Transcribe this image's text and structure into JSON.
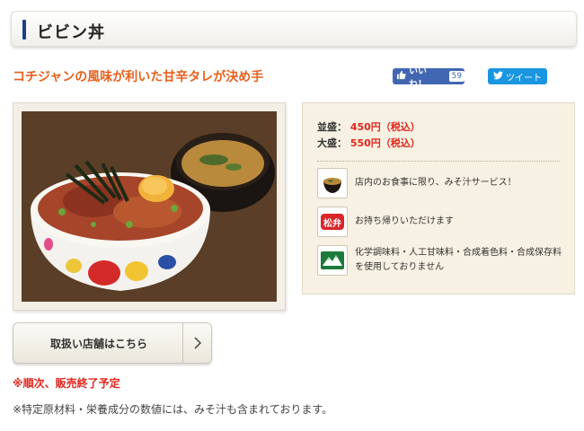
{
  "header": {
    "title": "ビビン丼"
  },
  "tagline": "コチジャンの風味が利いた甘辛タレが決め手",
  "social": {
    "like_label": "いいね！",
    "like_count": "59",
    "tweet_label": "ツイート"
  },
  "pricing": {
    "regular_label": "並盛：",
    "regular_price": "450円（税込）",
    "large_label": "大盛：",
    "large_price": "550円（税込）"
  },
  "services": [
    {
      "icon": "miso-soup-icon",
      "text": "店内のお食事に限り、みそ汁サービス！"
    },
    {
      "icon": "takeout-logo-icon",
      "logo_text": "松弁",
      "text": "お持ち帰りいただけます"
    },
    {
      "icon": "mountain-logo-icon",
      "text": "化学調味料・人工甘味料・合成着色料・合成保存料を使用しておりません"
    }
  ],
  "store_button": {
    "label": "取扱い店舗はこちら"
  },
  "notice": "※順次、販売終了予定",
  "note": "※特定原材料・栄養成分の数値には、みそ汁も含まれております。",
  "colors": {
    "accent": "#1f3f86",
    "tagline": "#e8601c",
    "price": "#e2261b",
    "facebook": "#4267b2",
    "twitter": "#1b95e0"
  }
}
